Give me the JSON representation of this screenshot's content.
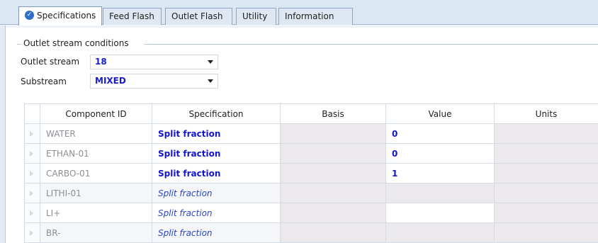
{
  "tabs": [
    {
      "label": "Specifications",
      "active": true,
      "icon": "check-circle-icon"
    },
    {
      "label": "Feed Flash",
      "active": false
    },
    {
      "label": "Outlet Flash",
      "active": false
    },
    {
      "label": "Utility",
      "active": false
    },
    {
      "label": "Information",
      "active": false
    }
  ],
  "group": {
    "title": "Outlet stream conditions",
    "outlet_stream_label": "Outlet stream",
    "outlet_stream_value": "18",
    "substream_label": "Substream",
    "substream_value": "MIXED"
  },
  "grid": {
    "headers": [
      "Component ID",
      "Specification",
      "Basis",
      "Value",
      "Units"
    ],
    "rows": [
      {
        "component": "WATER",
        "spec": "Split fraction",
        "value": "0"
      },
      {
        "component": "ETHAN-01",
        "spec": "Split fraction",
        "value": "0"
      },
      {
        "component": "CARBO-01",
        "spec": "Split fraction",
        "value": "1"
      },
      {
        "component": "LITHI-01",
        "spec": "Split fraction",
        "value": ""
      },
      {
        "component": "LI+",
        "spec": "Split fraction",
        "value": ""
      },
      {
        "component": "BR-",
        "spec": "Split fraction",
        "value": ""
      }
    ]
  },
  "colors": {
    "value_text": "#1414d0",
    "tab_background": "#dbe7f3",
    "shaded_cell": "#ebe9eb"
  }
}
